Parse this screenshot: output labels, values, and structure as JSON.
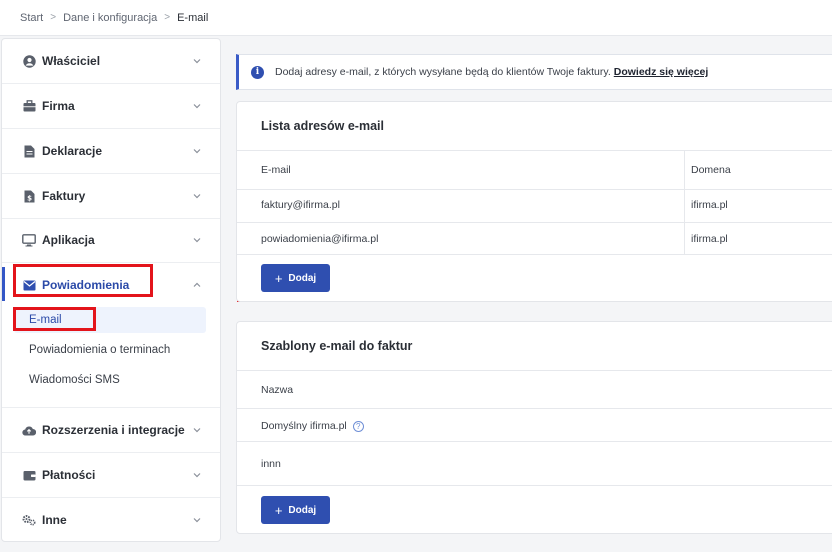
{
  "breadcrumb": {
    "items": [
      "Start",
      "Dane i konfiguracja",
      "E-mail"
    ],
    "separator": ">"
  },
  "sidebar": {
    "items": [
      {
        "label": "Właściciel",
        "icon": "user-circle-icon"
      },
      {
        "label": "Firma",
        "icon": "briefcase-icon"
      },
      {
        "label": "Deklaracje",
        "icon": "document-icon"
      },
      {
        "label": "Faktury",
        "icon": "invoice-icon"
      },
      {
        "label": "Aplikacja",
        "icon": "monitor-icon"
      },
      {
        "label": "Powiadomienia",
        "icon": "envelope-icon",
        "expanded": true
      },
      {
        "label": "Rozszerzenia i integracje",
        "icon": "cloud-upload-icon"
      },
      {
        "label": "Płatności",
        "icon": "wallet-icon"
      },
      {
        "label": "Inne",
        "icon": "gears-icon"
      }
    ],
    "subitems": [
      {
        "label": "E-mail",
        "active": true
      },
      {
        "label": "Powiadomienia o terminach"
      },
      {
        "label": "Wiadomości SMS"
      }
    ]
  },
  "info_banner": {
    "text": "Dodaj adresy e-mail, z których wysyłane będą do klientów Twoje faktury.",
    "link": "Dowiedz się więcej"
  },
  "email_list": {
    "title": "Lista adresów e-mail",
    "columns": [
      "E-mail",
      "Domena"
    ],
    "rows": [
      {
        "email": "faktury@ifirma.pl",
        "domain": "ifirma.pl"
      },
      {
        "email": "powiadomienia@ifirma.pl",
        "domain": "ifirma.pl"
      }
    ],
    "add_button": "Dodaj"
  },
  "templates": {
    "title": "Szablony e-mail do faktur",
    "column": "Nazwa",
    "rows": [
      "Domyślny ifirma.pl",
      "innn"
    ],
    "add_button": "Dodaj"
  },
  "colors": {
    "accent": "#2f4fb0",
    "highlight": "#e3141b"
  }
}
